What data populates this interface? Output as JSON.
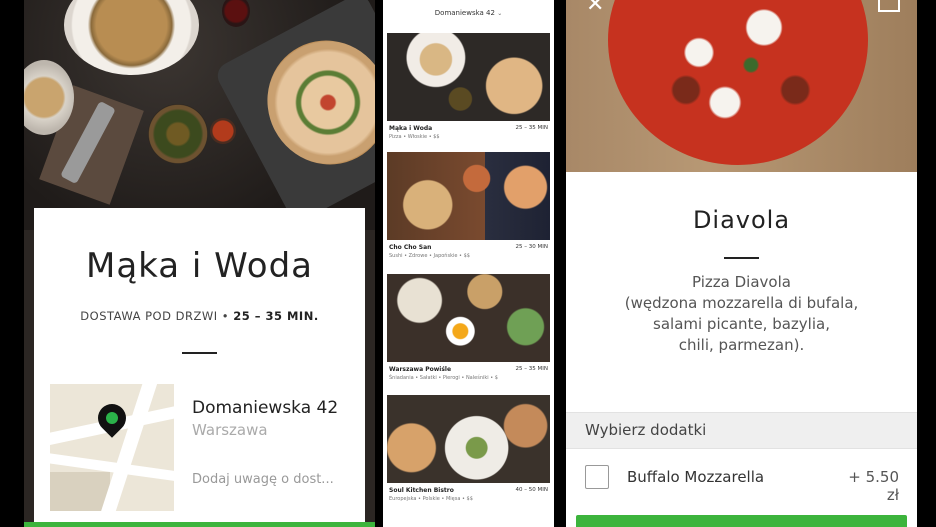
{
  "left_screen": {
    "restaurant_name": "Mąka i Woda",
    "delivery_label": "DOSTAWA POD DRZWI",
    "delivery_separator": "•",
    "delivery_time": "25 – 35 MIN.",
    "address": {
      "street": "Domaniewska 42",
      "city": "Warszawa"
    },
    "note_placeholder": "Dodaj uwagę o dost..."
  },
  "middle_screen": {
    "location_header": "Domaniewska 42",
    "location_chevron": "⌄",
    "restaurants": [
      {
        "name": "Mąka i Woda",
        "categories": "Pizza • Włoskie • $$",
        "eta": "25 – 35 MIN"
      },
      {
        "name": "Cho Cho San",
        "categories": "Sushi • Zdrowe • Japońskie • $$",
        "eta": "25 – 30 MIN"
      },
      {
        "name": "Warszawa Powiśle",
        "categories": "Śniadania • Sałatki • Pierogi • Naleśniki • $",
        "eta": "25 – 35 MIN"
      },
      {
        "name": "Soul Kitchen Bistro",
        "categories": "Europejska • Polskie • Mięsa • $$",
        "eta": "40 – 50 MIN"
      }
    ]
  },
  "right_screen": {
    "close_icon": "close-icon",
    "dish_name": "Diavola",
    "description": "Pizza Diavola (wędzona mozzarella di bufala, salami picante, bazylia, chili, parmezan).",
    "description_lines": [
      "Pizza Diavola",
      "(wędzona mozzarella di bufala,",
      "salami picante, bazylia,",
      "chili, parmezan)."
    ],
    "addons_header": "Wybierz dodatki",
    "addons": [
      {
        "name": "Buffalo Mozzarella",
        "price": "+ 5.50 zł",
        "checked": false
      }
    ]
  },
  "colors": {
    "accent_green": "#3cb43c",
    "pin_green": "#2bb24a",
    "background": "#000000"
  }
}
